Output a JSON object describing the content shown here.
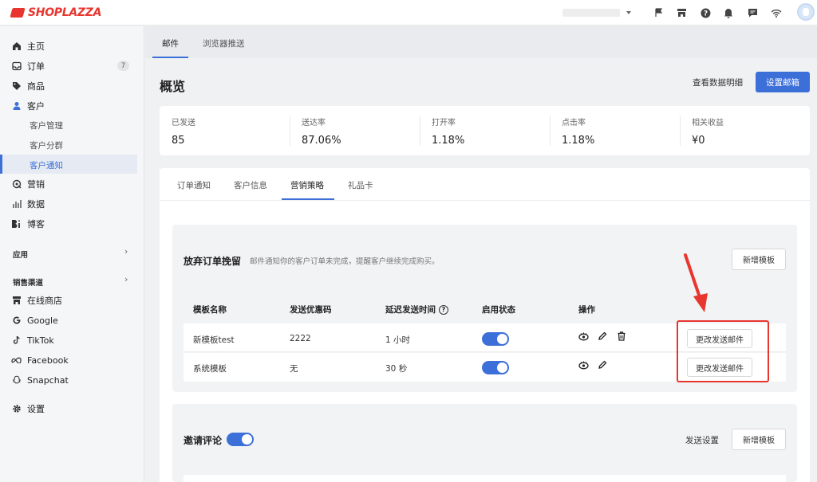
{
  "brand": {
    "name": "SHOPLAZZA",
    "color": "#e8362f"
  },
  "accent_color": "#3d6fd9",
  "topbar": {
    "icons": [
      "flag-icon",
      "store-icon",
      "help-icon",
      "bell-icon",
      "message-icon",
      "wifi-icon"
    ]
  },
  "sidebar": {
    "items": [
      {
        "label": "主页",
        "icon": "home-icon"
      },
      {
        "label": "订单",
        "icon": "inbox-icon",
        "badge": "7"
      },
      {
        "label": "商品",
        "icon": "tag-icon"
      },
      {
        "label": "客户",
        "icon": "user-icon"
      }
    ],
    "customer_sub": [
      "客户管理",
      "客户分群",
      "客户通知"
    ],
    "items2": [
      {
        "label": "营销",
        "icon": "marketing-icon"
      },
      {
        "label": "数据",
        "icon": "chart-icon"
      },
      {
        "label": "博客",
        "icon": "blog-icon"
      }
    ],
    "apps_label": "应用",
    "channels_label": "销售渠道",
    "channels": [
      {
        "label": "在线商店",
        "icon": "store-icon"
      },
      {
        "label": "Google",
        "icon": "google-icon"
      },
      {
        "label": "TikTok",
        "icon": "tiktok-icon"
      },
      {
        "label": "Facebook",
        "icon": "meta-icon"
      },
      {
        "label": "Snapchat",
        "icon": "snapchat-icon"
      }
    ],
    "settings_label": "设置"
  },
  "main_tabs": [
    "邮件",
    "浏览器推送"
  ],
  "overview": {
    "title": "概览",
    "detail_link": "查看数据明细",
    "setup_button": "设置邮箱",
    "stats": [
      {
        "label": "已发送",
        "value": "85"
      },
      {
        "label": "送达率",
        "value": "87.06%"
      },
      {
        "label": "打开率",
        "value": "1.18%"
      },
      {
        "label": "点击率",
        "value": "1.18%"
      },
      {
        "label": "相关收益",
        "value": "¥0"
      }
    ]
  },
  "content_tabs": [
    "订单通知",
    "客户信息",
    "营销策略",
    "礼品卡"
  ],
  "abandoned": {
    "title": "放弃订单挽留",
    "desc": "邮件通知你的客户订单未完成，提醒客户继续完成购买。",
    "add_button": "新增模板",
    "columns": [
      "模板名称",
      "发送优惠码",
      "延迟发送时间",
      "启用状态",
      "操作"
    ],
    "rows": [
      {
        "name": "新模板test",
        "code": "2222",
        "delay": "1 小时",
        "enabled": true,
        "action": "更改发送邮件"
      },
      {
        "name": "系统模板",
        "code": "无",
        "delay": "30 秒",
        "enabled": true,
        "action": "更改发送邮件"
      }
    ]
  },
  "review": {
    "title": "邀请评论",
    "enabled": true,
    "send_settings": "发送设置",
    "add_button": "新增模板"
  }
}
